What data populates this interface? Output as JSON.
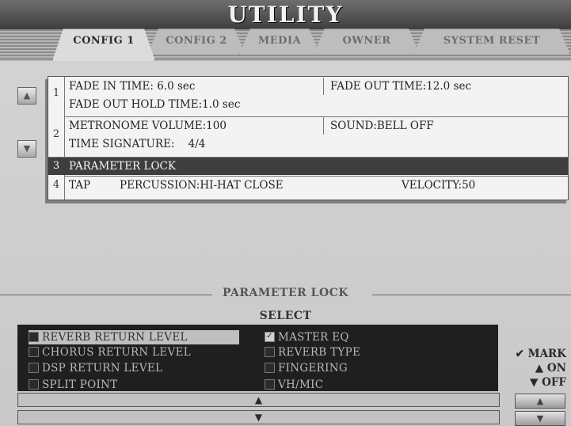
{
  "title": "UTILITY",
  "tabs": [
    {
      "label": "CONFIG 1",
      "active": true
    },
    {
      "label": "CONFIG 2",
      "active": false
    },
    {
      "label": "MEDIA",
      "active": false
    },
    {
      "label": "OWNER",
      "active": false
    },
    {
      "label": "SYSTEM RESET",
      "active": false
    }
  ],
  "config_list": {
    "groups": [
      "1",
      "2",
      "3",
      "4"
    ],
    "rows": {
      "fade_in": "FADE IN TIME:  6.0 sec",
      "fade_out": "FADE OUT TIME:12.0 sec",
      "fade_out_hold": "FADE OUT HOLD TIME:1.0 sec",
      "metronome_volume": "METRONOME VOLUME:100",
      "sound": "SOUND:BELL OFF",
      "time_signature": "TIME SIGNATURE:    4/4",
      "parameter_lock": "PARAMETER LOCK",
      "tap": "TAP",
      "tap_percussion": "PERCUSSION:HI-HAT CLOSE",
      "tap_velocity": "VELOCITY:50"
    },
    "selected_row": "PARAMETER LOCK"
  },
  "parameter_lock": {
    "section_title": "PARAMETER LOCK",
    "select_label": "SELECT",
    "items": [
      {
        "label": "REVERB RETURN LEVEL",
        "checked": false,
        "selected": true
      },
      {
        "label": "CHORUS RETURN LEVEL",
        "checked": false,
        "selected": false
      },
      {
        "label": "DSP RETURN LEVEL",
        "checked": false,
        "selected": false
      },
      {
        "label": "SPLIT POINT",
        "checked": false,
        "selected": false
      },
      {
        "label": "MASTER EQ",
        "checked": true,
        "selected": false
      },
      {
        "label": "REVERB TYPE",
        "checked": false,
        "selected": false
      },
      {
        "label": "FINGERING",
        "checked": false,
        "selected": false
      },
      {
        "label": "VH/MIC",
        "checked": false,
        "selected": false
      }
    ]
  },
  "side_controls": {
    "mark_label": "MARK",
    "on_label": "ON",
    "off_label": "OFF"
  },
  "icons": {
    "list_up": "triangle-up-icon",
    "list_down": "triangle-down-icon",
    "scroll_up": "scroll-up-icon",
    "scroll_down": "scroll-down-icon",
    "mark": "check-mark-icon"
  },
  "colors": {
    "highlight_row": "#3e3e3e",
    "list_bg": "#1f1f1f",
    "selected_item": "#bfbfbf"
  }
}
